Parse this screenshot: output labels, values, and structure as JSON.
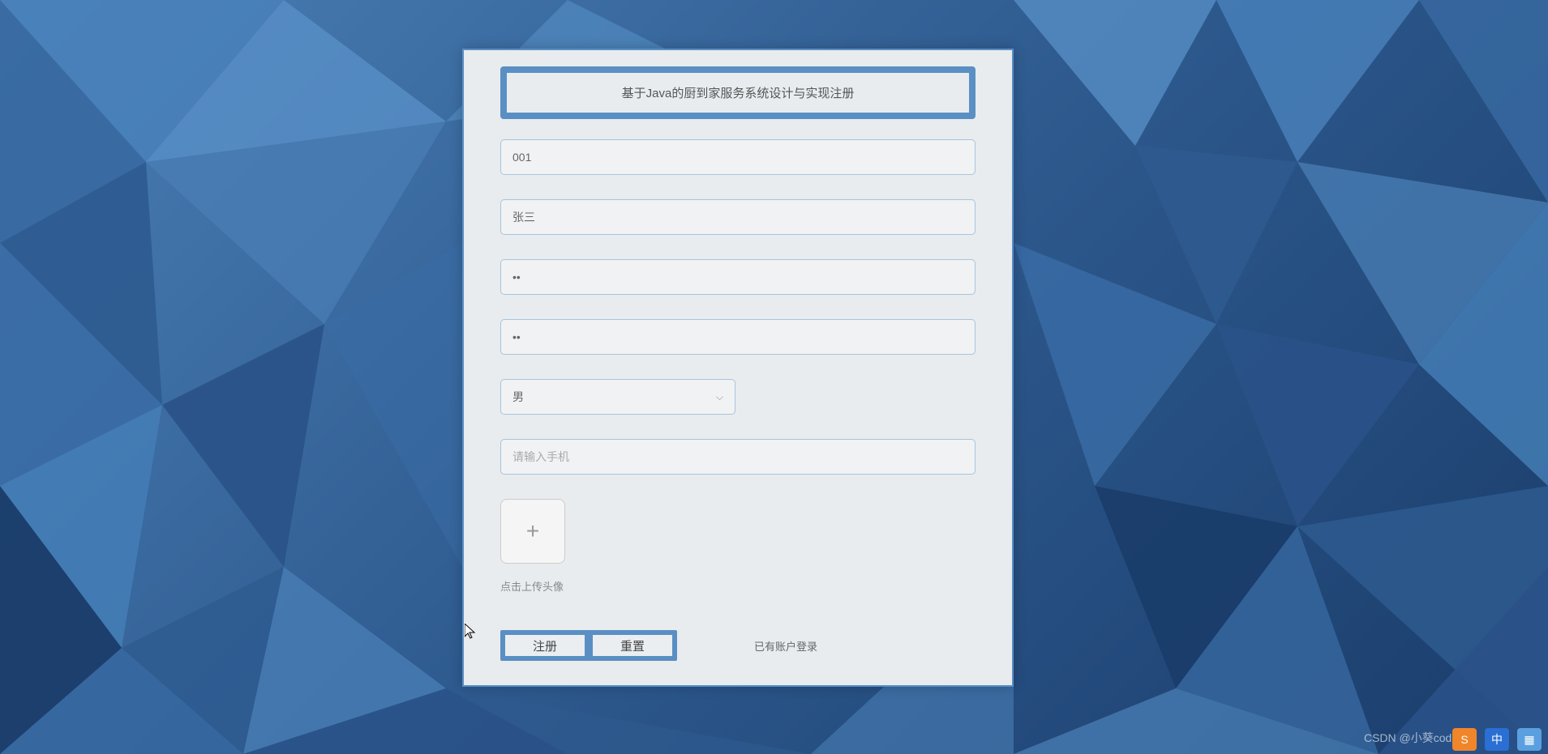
{
  "form": {
    "title": "基于Java的厨到家服务系统设计与实现注册",
    "fields": {
      "account": {
        "value": "001"
      },
      "name": {
        "value": "张三"
      },
      "password": {
        "value": "••"
      },
      "confirm_password": {
        "value": "••"
      },
      "gender": {
        "selected": "男"
      },
      "phone": {
        "placeholder": "请输入手机",
        "value": ""
      }
    },
    "upload": {
      "icon": "+",
      "hint": "点击上传头像"
    },
    "buttons": {
      "register": "注册",
      "reset": "重置"
    },
    "login_link": "已有账户登录"
  },
  "watermark": "CSDN @小葵coding"
}
